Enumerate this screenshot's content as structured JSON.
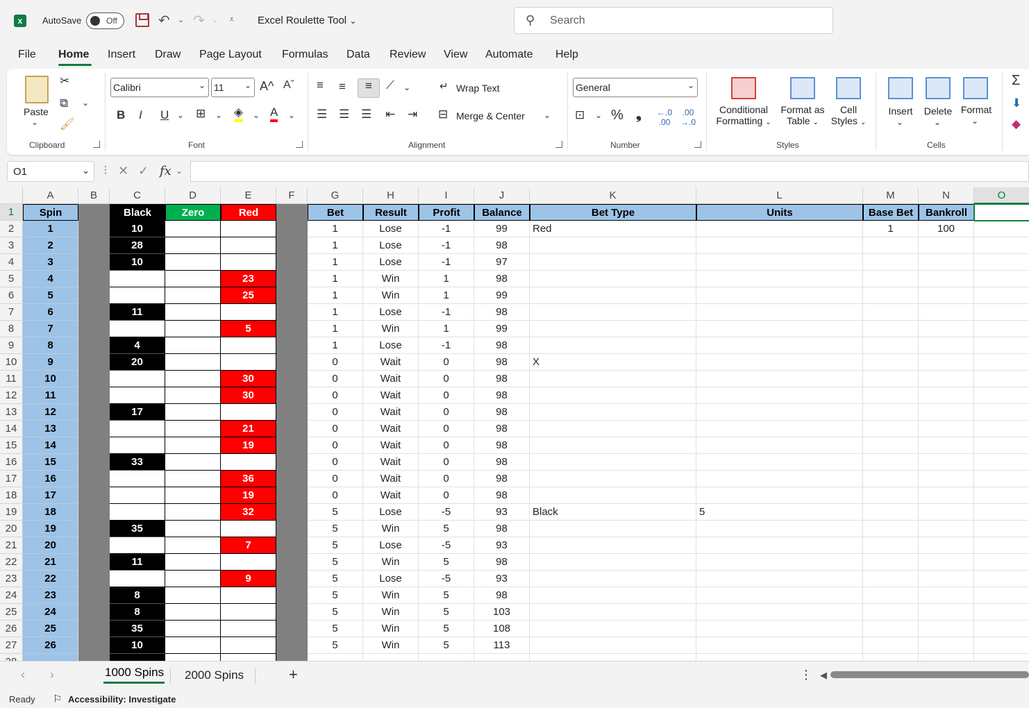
{
  "titlebar": {
    "autosave_label": "AutoSave",
    "toggle_state": "Off",
    "doc_title": "Excel Roulette Tool",
    "search_placeholder": "Search"
  },
  "menu": [
    "File",
    "Home",
    "Insert",
    "Draw",
    "Page Layout",
    "Formulas",
    "Data",
    "Review",
    "View",
    "Automate",
    "Help"
  ],
  "ribbon": {
    "clipboard": {
      "paste": "Paste",
      "group": "Clipboard"
    },
    "font": {
      "family": "Calibri",
      "size": "11",
      "group": "Font"
    },
    "alignment": {
      "wrap": "Wrap Text",
      "merge": "Merge & Center",
      "group": "Alignment"
    },
    "number": {
      "format": "General",
      "group": "Number"
    },
    "styles": {
      "conditional_1": "Conditional",
      "conditional_2": "Formatting",
      "format_table_1": "Format as",
      "format_table_2": "Table",
      "cell_styles_1": "Cell",
      "cell_styles_2": "Styles",
      "group": "Styles"
    },
    "cells": {
      "insert": "Insert",
      "delete": "Delete",
      "format": "Format",
      "group": "Cells"
    }
  },
  "formula_bar": {
    "name_box": "O1",
    "fx": "fx",
    "content": ""
  },
  "columns": [
    "A",
    "B",
    "C",
    "D",
    "E",
    "F",
    "G",
    "H",
    "I",
    "J",
    "K",
    "L",
    "M",
    "N",
    "O"
  ],
  "headers": {
    "spin": "Spin",
    "black": "Black",
    "zero": "Zero",
    "red": "Red",
    "bet": "Bet",
    "result": "Result",
    "profit": "Profit",
    "balance": "Balance",
    "bet_type": "Bet Type",
    "units": "Units",
    "base_bet": "Base Bet",
    "bankroll": "Bankroll"
  },
  "rows": [
    {
      "n": "2",
      "spin": "1",
      "black": "10",
      "red": "",
      "bet": "1",
      "result": "Lose",
      "profit": "-1",
      "balance": "99",
      "bet_type": "Red",
      "units": "",
      "base_bet": "1",
      "bankroll": "100"
    },
    {
      "n": "3",
      "spin": "2",
      "black": "28",
      "red": "",
      "bet": "1",
      "result": "Lose",
      "profit": "-1",
      "balance": "98",
      "bet_type": "",
      "units": "",
      "base_bet": "",
      "bankroll": ""
    },
    {
      "n": "4",
      "spin": "3",
      "black": "10",
      "red": "",
      "bet": "1",
      "result": "Lose",
      "profit": "-1",
      "balance": "97",
      "bet_type": "",
      "units": "",
      "base_bet": "",
      "bankroll": ""
    },
    {
      "n": "5",
      "spin": "4",
      "black": "",
      "red": "23",
      "bet": "1",
      "result": "Win",
      "profit": "1",
      "balance": "98",
      "bet_type": "",
      "units": "",
      "base_bet": "",
      "bankroll": ""
    },
    {
      "n": "6",
      "spin": "5",
      "black": "",
      "red": "25",
      "bet": "1",
      "result": "Win",
      "profit": "1",
      "balance": "99",
      "bet_type": "",
      "units": "",
      "base_bet": "",
      "bankroll": ""
    },
    {
      "n": "7",
      "spin": "6",
      "black": "11",
      "red": "",
      "bet": "1",
      "result": "Lose",
      "profit": "-1",
      "balance": "98",
      "bet_type": "",
      "units": "",
      "base_bet": "",
      "bankroll": ""
    },
    {
      "n": "8",
      "spin": "7",
      "black": "",
      "red": "5",
      "bet": "1",
      "result": "Win",
      "profit": "1",
      "balance": "99",
      "bet_type": "",
      "units": "",
      "base_bet": "",
      "bankroll": ""
    },
    {
      "n": "9",
      "spin": "8",
      "black": "4",
      "red": "",
      "bet": "1",
      "result": "Lose",
      "profit": "-1",
      "balance": "98",
      "bet_type": "",
      "units": "",
      "base_bet": "",
      "bankroll": ""
    },
    {
      "n": "10",
      "spin": "9",
      "black": "20",
      "red": "",
      "bet": "0",
      "result": "Wait",
      "profit": "0",
      "balance": "98",
      "bet_type": "X",
      "units": "",
      "base_bet": "",
      "bankroll": ""
    },
    {
      "n": "11",
      "spin": "10",
      "black": "",
      "red": "30",
      "bet": "0",
      "result": "Wait",
      "profit": "0",
      "balance": "98",
      "bet_type": "",
      "units": "",
      "base_bet": "",
      "bankroll": ""
    },
    {
      "n": "12",
      "spin": "11",
      "black": "",
      "red": "30",
      "bet": "0",
      "result": "Wait",
      "profit": "0",
      "balance": "98",
      "bet_type": "",
      "units": "",
      "base_bet": "",
      "bankroll": ""
    },
    {
      "n": "13",
      "spin": "12",
      "black": "17",
      "red": "",
      "bet": "0",
      "result": "Wait",
      "profit": "0",
      "balance": "98",
      "bet_type": "",
      "units": "",
      "base_bet": "",
      "bankroll": ""
    },
    {
      "n": "14",
      "spin": "13",
      "black": "",
      "red": "21",
      "bet": "0",
      "result": "Wait",
      "profit": "0",
      "balance": "98",
      "bet_type": "",
      "units": "",
      "base_bet": "",
      "bankroll": ""
    },
    {
      "n": "15",
      "spin": "14",
      "black": "",
      "red": "19",
      "bet": "0",
      "result": "Wait",
      "profit": "0",
      "balance": "98",
      "bet_type": "",
      "units": "",
      "base_bet": "",
      "bankroll": ""
    },
    {
      "n": "16",
      "spin": "15",
      "black": "33",
      "red": "",
      "bet": "0",
      "result": "Wait",
      "profit": "0",
      "balance": "98",
      "bet_type": "",
      "units": "",
      "base_bet": "",
      "bankroll": ""
    },
    {
      "n": "17",
      "spin": "16",
      "black": "",
      "red": "36",
      "bet": "0",
      "result": "Wait",
      "profit": "0",
      "balance": "98",
      "bet_type": "",
      "units": "",
      "base_bet": "",
      "bankroll": ""
    },
    {
      "n": "18",
      "spin": "17",
      "black": "",
      "red": "19",
      "bet": "0",
      "result": "Wait",
      "profit": "0",
      "balance": "98",
      "bet_type": "",
      "units": "",
      "base_bet": "",
      "bankroll": ""
    },
    {
      "n": "19",
      "spin": "18",
      "black": "",
      "red": "32",
      "bet": "5",
      "result": "Lose",
      "profit": "-5",
      "balance": "93",
      "bet_type": "Black",
      "units": "5",
      "base_bet": "",
      "bankroll": ""
    },
    {
      "n": "20",
      "spin": "19",
      "black": "35",
      "red": "",
      "bet": "5",
      "result": "Win",
      "profit": "5",
      "balance": "98",
      "bet_type": "",
      "units": "",
      "base_bet": "",
      "bankroll": ""
    },
    {
      "n": "21",
      "spin": "20",
      "black": "",
      "red": "7",
      "bet": "5",
      "result": "Lose",
      "profit": "-5",
      "balance": "93",
      "bet_type": "",
      "units": "",
      "base_bet": "",
      "bankroll": ""
    },
    {
      "n": "22",
      "spin": "21",
      "black": "11",
      "red": "",
      "bet": "5",
      "result": "Win",
      "profit": "5",
      "balance": "98",
      "bet_type": "",
      "units": "",
      "base_bet": "",
      "bankroll": ""
    },
    {
      "n": "23",
      "spin": "22",
      "black": "",
      "red": "9",
      "bet": "5",
      "result": "Lose",
      "profit": "-5",
      "balance": "93",
      "bet_type": "",
      "units": "",
      "base_bet": "",
      "bankroll": ""
    },
    {
      "n": "24",
      "spin": "23",
      "black": "8",
      "red": "",
      "bet": "5",
      "result": "Win",
      "profit": "5",
      "balance": "98",
      "bet_type": "",
      "units": "",
      "base_bet": "",
      "bankroll": ""
    },
    {
      "n": "25",
      "spin": "24",
      "black": "8",
      "red": "",
      "bet": "5",
      "result": "Win",
      "profit": "5",
      "balance": "103",
      "bet_type": "",
      "units": "",
      "base_bet": "",
      "bankroll": ""
    },
    {
      "n": "26",
      "spin": "25",
      "black": "35",
      "red": "",
      "bet": "5",
      "result": "Win",
      "profit": "5",
      "balance": "108",
      "bet_type": "",
      "units": "",
      "base_bet": "",
      "bankroll": ""
    },
    {
      "n": "27",
      "spin": "26",
      "black": "10",
      "red": "",
      "bet": "5",
      "result": "Win",
      "profit": "5",
      "balance": "113",
      "bet_type": "",
      "units": "",
      "base_bet": "",
      "bankroll": ""
    }
  ],
  "sheets": [
    "1000 Spins",
    "2000 Spins"
  ],
  "status": {
    "ready": "Ready",
    "accessibility": "Accessibility: Investigate"
  },
  "colors": {
    "accent": "#107c41",
    "header_blue": "#9dc3e6",
    "red": "#ff0000",
    "green": "#00b050",
    "gray": "#808080"
  }
}
